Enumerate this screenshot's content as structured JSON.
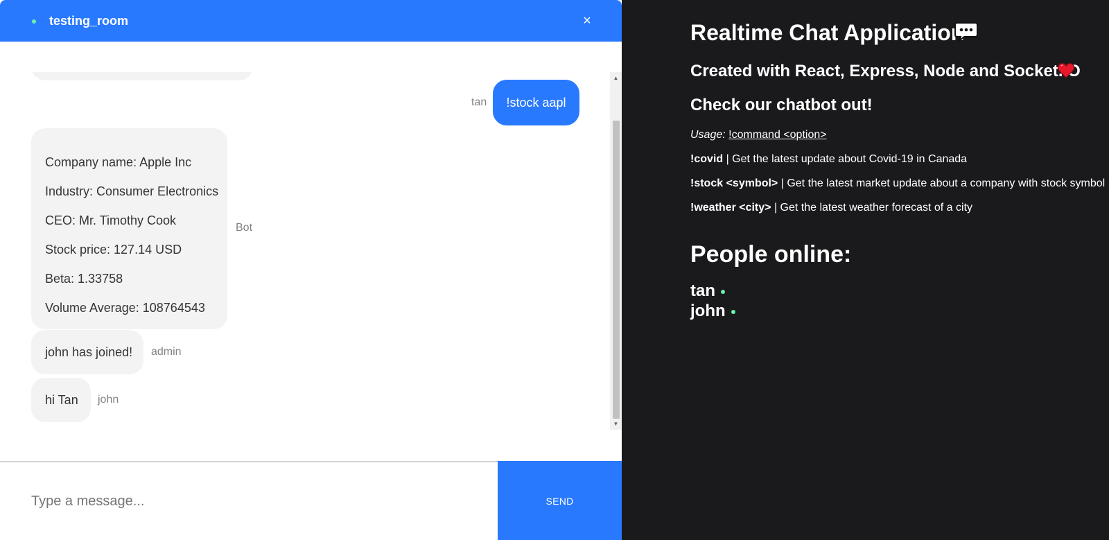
{
  "chat": {
    "room_name": "testing_room",
    "close_label": "×",
    "messages": {
      "me": {
        "sender": "tan",
        "text": "!stock aapl"
      },
      "bot": {
        "sender": "Bot",
        "lines": [
          "Company name: Apple Inc",
          "Industry: Consumer Electronics",
          "CEO: Mr. Timothy Cook",
          "Stock price: 127.14 USD",
          "Beta: 1.33758",
          "Volume Average: 108764543"
        ]
      },
      "admin": {
        "sender": "admin",
        "text": "john has joined!"
      },
      "john": {
        "sender": "john",
        "text": "hi Tan"
      }
    },
    "input_placeholder": "Type a message...",
    "send_label": "SEND"
  },
  "info": {
    "title": "Realtime Chat Application",
    "created": "Created with React, Express, Node and Socket.IO",
    "check": "Check our chatbot out!",
    "usage_label": "Usage:",
    "usage_command": "!command <option>",
    "commands": [
      {
        "cmd": "!covid",
        "desc": " | Get the latest update about Covid-19 in Canada"
      },
      {
        "cmd": "!stock <symbol>",
        "desc": " | Get the latest market update about a company with stock symbol"
      },
      {
        "cmd": "!weather <city>",
        "desc": " | Get the latest weather forecast of a city"
      }
    ],
    "people_title": "People online:",
    "people": [
      "tan",
      "john"
    ]
  },
  "colors": {
    "accent": "#2979ff",
    "online": "#69f0ae",
    "background": "#1a1a1d",
    "bubble": "#f3f3f3"
  },
  "icons": {
    "chat": "speech-balloon-icon",
    "heart": "heart-icon"
  }
}
